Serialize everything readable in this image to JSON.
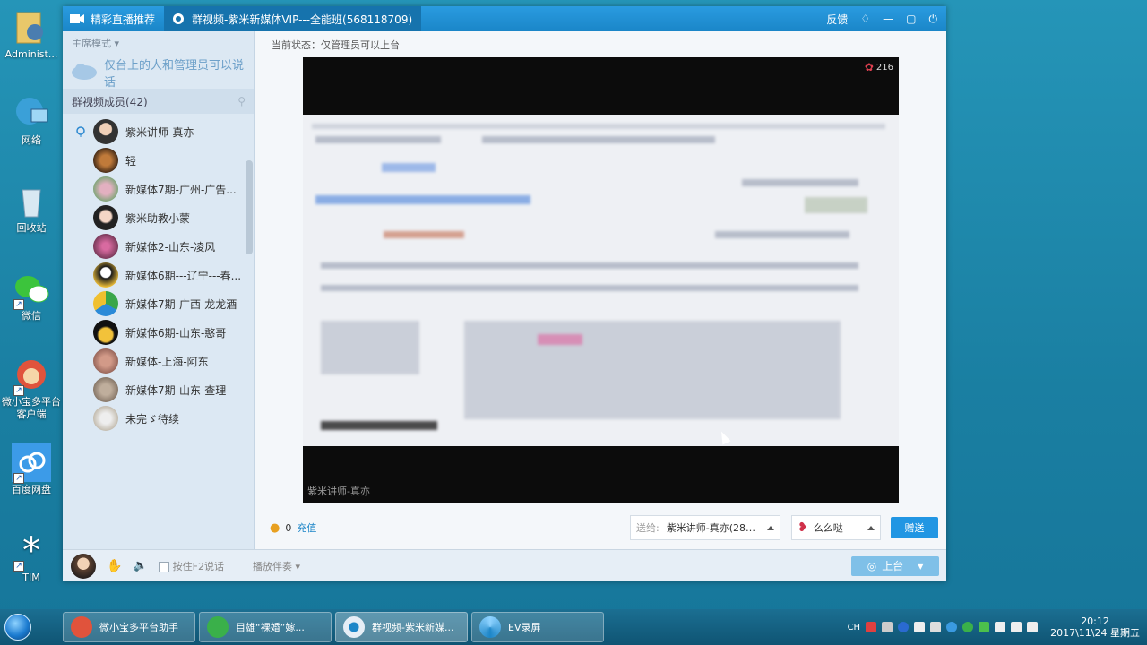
{
  "desktop": {
    "icons": [
      {
        "label": "Administ..."
      },
      {
        "label": "网络"
      },
      {
        "label": "回收站"
      },
      {
        "label": "微信"
      },
      {
        "label": "微小宝多平台客户端"
      },
      {
        "label": "百度网盘"
      },
      {
        "label": "TIM"
      }
    ]
  },
  "window": {
    "tabs": [
      {
        "label": "精彩直播推荐"
      },
      {
        "label": "群视频-紫米新媒体VIP---全能班(568118709)"
      }
    ],
    "title_actions": {
      "feedback": "反馈"
    },
    "sidebar": {
      "mode": "主席模式",
      "notice": "仅台上的人和管理员可以说话",
      "members_header": "群视频成员(42)",
      "members": [
        {
          "name": "紫米讲师-真亦"
        },
        {
          "name": "轻"
        },
        {
          "name": "新媒体7期-广州-广告..."
        },
        {
          "name": "紫米助教小蒙"
        },
        {
          "name": "新媒体2-山东-凌风"
        },
        {
          "name": "新媒体6期---辽宁---春..."
        },
        {
          "name": "新媒体7期-广西-龙龙酒"
        },
        {
          "name": "新媒体6期-山东-憨哥"
        },
        {
          "name": "新媒体-上海-阿东"
        },
        {
          "name": "新媒体7期-山东-查理"
        },
        {
          "name": "未完ゞ待续"
        }
      ]
    },
    "main": {
      "status": "当前状态：仅管理员可以上台",
      "flower_count": "216",
      "video_caption": "紫米讲师-真亦",
      "coins": "0",
      "recharge": "充值",
      "send_to_label": "送给:",
      "send_to_value": "紫米讲师-真亦(2805...",
      "gift_name": "么么哒",
      "gift_button": "赠送"
    },
    "bottom": {
      "push_to_talk": "按住F2说话",
      "play_accompany": "播放伴奏",
      "go_stage": "上台"
    }
  },
  "taskbar": {
    "buttons": [
      {
        "label": "微小宝多平台助手"
      },
      {
        "label": "目雄“裸婚”嫁..."
      },
      {
        "label": "群视频-紫米新媒..."
      },
      {
        "label": "EV录屏"
      }
    ],
    "tray": {
      "lang": "CH",
      "time": "20:12",
      "date": "2017\\11\\24 星期五"
    }
  }
}
